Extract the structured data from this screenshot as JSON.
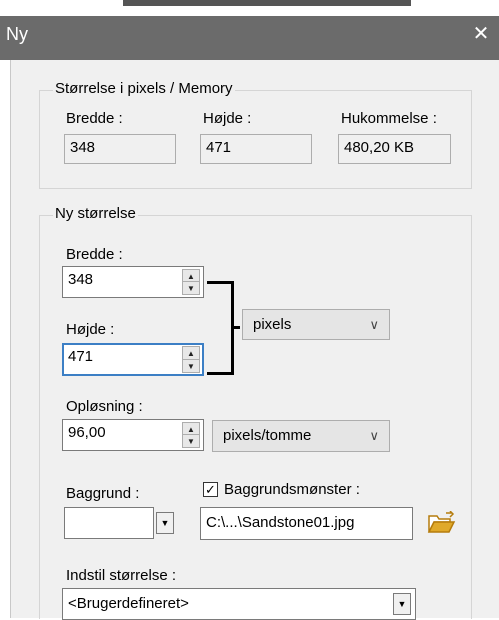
{
  "window": {
    "title": "Ny",
    "close_glyph": "✕"
  },
  "memory_group": {
    "legend": "Størrelse i pixels / Memory",
    "width_label": "Bredde :",
    "width_value": "348",
    "height_label": "Højde :",
    "height_value": "471",
    "memory_label": "Hukommelse :",
    "memory_value": "480,20 KB"
  },
  "new_size_group": {
    "legend": "Ny størrelse",
    "width_label": "Bredde :",
    "width_value": "348",
    "height_label": "Højde :",
    "height_value": "471",
    "unit_selected": "pixels",
    "resolution_label": "Opløsning :",
    "resolution_value": "96,00",
    "resolution_unit_selected": "pixels/tomme",
    "background_label": "Baggrund :",
    "pattern_label": "Baggrundsmønster :",
    "pattern_checked": true,
    "pattern_file": "C:\\...\\Sandstone01.jpg",
    "preset_label": "Indstil størrelse :",
    "preset_selected": "<Brugerdefineret>"
  },
  "icons": {
    "folder": "folder-open-icon",
    "spin_up": "▲",
    "spin_down": "▼",
    "dropdown": "▼",
    "chevron": "∨",
    "check": "✓"
  },
  "colors": {
    "titlebar": "#6b6b6b",
    "dialog_bg": "#f0f0f0",
    "focus_border": "#3c7fc5",
    "folder_icon": "#e0a92a"
  }
}
